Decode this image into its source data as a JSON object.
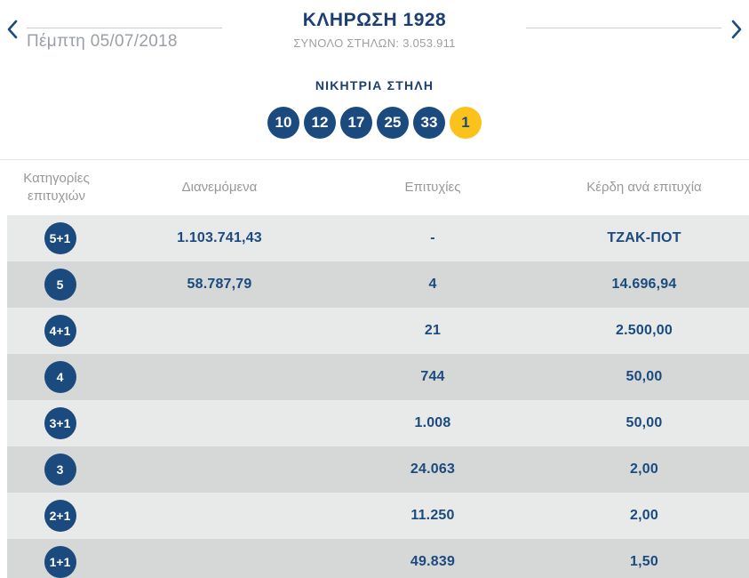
{
  "header": {
    "title": "ΚΛΗΡΩΣΗ 1928",
    "subtitle": "ΣΥΝΟΛΟ ΣΤΗΛΩΝ: 3.053.911",
    "date": "Πέμπτη 05/07/2018",
    "prev_icon": "chevron-left",
    "next_icon": "chevron-right"
  },
  "winning": {
    "title": "ΝΙΚΗΤΡΙΑ ΣΤΗΛΗ",
    "numbers": [
      "10",
      "12",
      "17",
      "25",
      "33"
    ],
    "bonus": "1"
  },
  "results_table": {
    "columns": [
      "Κατηγορίες επιτυχιών",
      "Διανεμόμενα",
      "Επιτυχίες",
      "Κέρδη ανά επιτυχία"
    ],
    "rows": [
      {
        "category": "5+1",
        "distributed": "1.103.741,43",
        "winners": "-",
        "prize": "ΤΖΑΚ-ΠΟΤ"
      },
      {
        "category": "5",
        "distributed": "58.787,79",
        "winners": "4",
        "prize": "14.696,94"
      },
      {
        "category": "4+1",
        "distributed": "",
        "winners": "21",
        "prize": "2.500,00"
      },
      {
        "category": "4",
        "distributed": "",
        "winners": "744",
        "prize": "50,00"
      },
      {
        "category": "3+1",
        "distributed": "",
        "winners": "1.008",
        "prize": "50,00"
      },
      {
        "category": "3",
        "distributed": "",
        "winners": "24.063",
        "prize": "2,00"
      },
      {
        "category": "2+1",
        "distributed": "",
        "winners": "11.250",
        "prize": "2,00"
      },
      {
        "category": "1+1",
        "distributed": "",
        "winners": "49.839",
        "prize": "1,50"
      }
    ]
  },
  "colors": {
    "navy": "#1b4a7e",
    "navy_text": "#1b3f72",
    "bonus_yellow": "#fbc21b",
    "row_light": "#e8e9e9",
    "row_dark": "#d6d8d8",
    "gray_text": "#9aa0a5",
    "header_gray_text": "#96989b"
  }
}
